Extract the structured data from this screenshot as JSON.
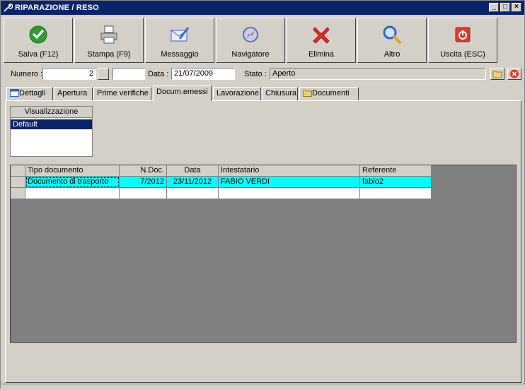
{
  "window": {
    "title": "RIPARAZIONE / RESO",
    "controls": [
      "_",
      "□",
      "×"
    ]
  },
  "toolbar": [
    {
      "label": "Salva (F12)",
      "icon": "check-icon",
      "color": "#2e9e2e"
    },
    {
      "label": "Stampa (F9)",
      "icon": "printer-icon",
      "color": "#9a9a9a"
    },
    {
      "label": "Messaggio",
      "icon": "envelope-pen-icon",
      "color": "#3a5fbf"
    },
    {
      "label": "Navigatore",
      "icon": "compass-icon",
      "color": "#5a6cc0"
    },
    {
      "label": "Elimina",
      "icon": "x-mark-icon",
      "color": "#e0301e"
    },
    {
      "label": "Altro",
      "icon": "magnifier-icon",
      "color": "#2a66c8"
    },
    {
      "label": "Uscita (ESC)",
      "icon": "power-icon",
      "color": "#e03a2a"
    }
  ],
  "header": {
    "numero_label": "Numero :",
    "numero_value": "2",
    "numero_extra": "",
    "data_label": "Data :",
    "data_value": "21/07/2009",
    "stato_label": "Stato :",
    "stato_value": "Aperto"
  },
  "tabs": [
    {
      "label": "Dettagli",
      "icon": "window-icon"
    },
    {
      "label": "Apertura"
    },
    {
      "label": "Prime verifiche"
    },
    {
      "label": "Docum.emessi",
      "active": true
    },
    {
      "label": "Lavorazione"
    },
    {
      "label": "Chiusura"
    },
    {
      "label": "Documenti",
      "icon": "folder-icon"
    }
  ],
  "visualizzazione": {
    "header": "Visualizzazione",
    "selected": "Default"
  },
  "table": {
    "columns": [
      "Tipo documento",
      "N.Doc.",
      "Data",
      "Intestatario",
      "Referente"
    ],
    "rows": [
      [
        "Documento di trasporto",
        "7/2012",
        "23/11/2012",
        "FABIO VERDI",
        "fabio2"
      ],
      [
        "",
        "",
        "",
        "",
        ""
      ]
    ]
  }
}
